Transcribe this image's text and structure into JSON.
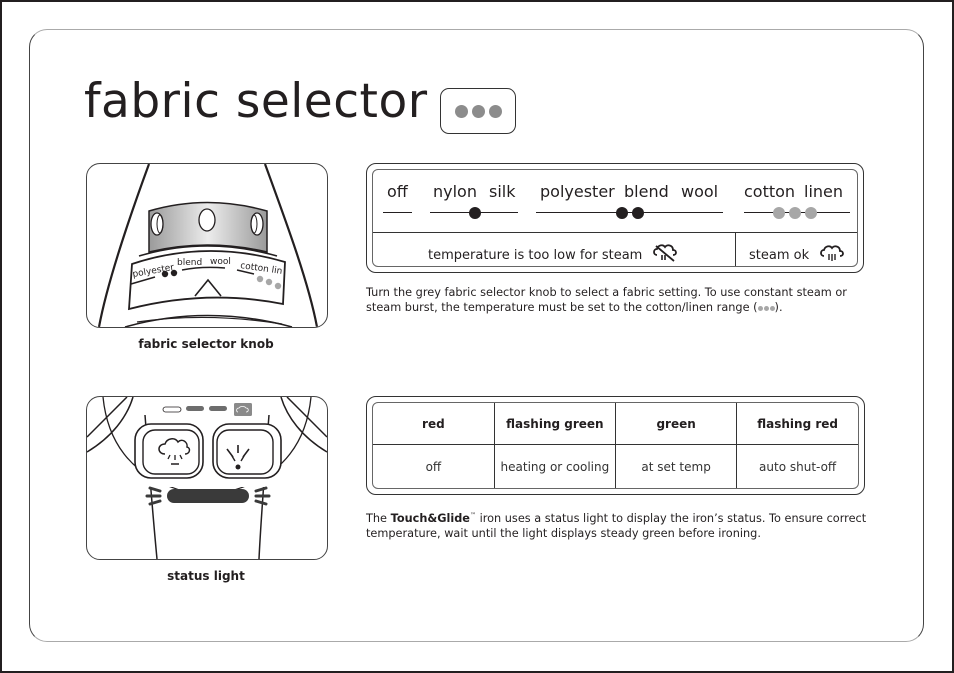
{
  "page": {
    "title": "fabric selector",
    "title_badge": {
      "icon": "three-grey-dots",
      "dot_count": 3,
      "dot_color": "#8c8c8c"
    }
  },
  "colors": {
    "ink": "#231f20",
    "grey_dot": "#a7a7a7",
    "dark_dot": "#231f20"
  },
  "fabric_knob": {
    "caption": "fabric selector knob",
    "dial_labels": [
      "polyester",
      "blend",
      "wool",
      "cotton",
      "lin"
    ]
  },
  "fabric_chart": {
    "settings": [
      {
        "label": "off",
        "dots": 0,
        "dot_color": "none"
      },
      {
        "label": "nylon",
        "dots": 1,
        "dot_color": "dark"
      },
      {
        "label": "silk",
        "dots": 1,
        "dot_color": "dark"
      },
      {
        "label": "polyester",
        "dots": 2,
        "dot_color": "dark"
      },
      {
        "label": "blend",
        "dots": 2,
        "dot_color": "dark"
      },
      {
        "label": "wool",
        "dots": 2,
        "dot_color": "dark"
      },
      {
        "label": "cotton",
        "dots": 3,
        "dot_color": "grey"
      },
      {
        "label": "linen",
        "dots": 3,
        "dot_color": "grey"
      }
    ],
    "status_low": {
      "text": "temperature is too low for steam",
      "icon": "no-steam-icon"
    },
    "status_ok": {
      "text": "steam ok",
      "icon": "steam-icon"
    }
  },
  "fabric_description": {
    "text": "Turn the grey fabric selector knob to select a fabric setting.  To use constant steam or steam burst, the temperature must be set to the cotton/linen range (",
    "text_end": ")."
  },
  "status_light": {
    "caption": "status light",
    "headers": [
      "red",
      "flashing green",
      "green",
      "flashing red"
    ],
    "values": [
      "off",
      "heating or cooling",
      "at set temp",
      "auto shut-off"
    ]
  },
  "status_description": {
    "prefix": "The ",
    "brand": "Touch&Glide",
    "trademark": "™",
    "text": " iron uses a status light to display the iron’s status.  To ensure correct temperature, wait until the light displays steady green before ironing."
  }
}
